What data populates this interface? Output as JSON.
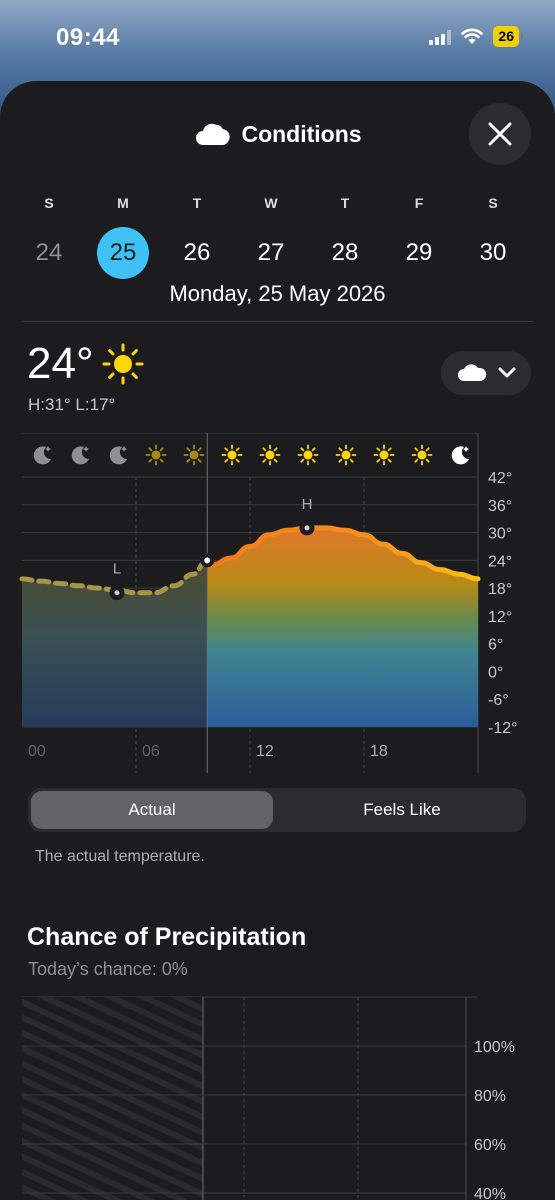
{
  "status_bar": {
    "time": "09:44",
    "battery": "26"
  },
  "header": {
    "title": "Conditions",
    "icon": "cloud-icon",
    "close_icon": "close-icon"
  },
  "week": [
    {
      "letter": "S",
      "num": "24",
      "state": "past"
    },
    {
      "letter": "M",
      "num": "25",
      "state": "selected"
    },
    {
      "letter": "T",
      "num": "26",
      "state": "future"
    },
    {
      "letter": "W",
      "num": "27",
      "state": "future"
    },
    {
      "letter": "T",
      "num": "28",
      "state": "future"
    },
    {
      "letter": "F",
      "num": "29",
      "state": "future"
    },
    {
      "letter": "S",
      "num": "30",
      "state": "future"
    }
  ],
  "selected_date": "Monday, 25 May 2026",
  "current": {
    "temp": "24°",
    "condition_icon": "sun-icon",
    "high_low": "H:31° L:17°"
  },
  "metric_selector": {
    "icon": "cloud-icon",
    "chevron": "chevron-down-icon"
  },
  "temperature_chart": {
    "hourly_icons": [
      "moon-icon",
      "moon-icon",
      "moon-icon",
      "sun-dim-icon",
      "sun-dim-icon",
      "sun-icon",
      "sun-icon",
      "sun-icon",
      "sun-icon",
      "sun-icon",
      "sun-icon",
      "moon-icon"
    ],
    "y_ticks": [
      "42°",
      "36°",
      "30°",
      "24°",
      "18°",
      "12°",
      "6°",
      "0°",
      "-6°",
      "-12°"
    ],
    "x_ticks": [
      "00",
      "06",
      "12",
      "18"
    ],
    "high_label": "H",
    "low_label": "L",
    "chart_data": {
      "type": "line",
      "x": [
        0,
        1,
        2,
        3,
        4,
        5,
        6,
        7,
        8,
        9,
        10,
        11,
        12,
        13,
        14,
        15,
        16,
        17,
        18,
        19,
        20,
        21,
        22,
        23,
        24
      ],
      "values": [
        20,
        19.5,
        19,
        18.5,
        18,
        17.5,
        17,
        17,
        18.5,
        21,
        23,
        24.5,
        27,
        29.5,
        30.5,
        31,
        31,
        30.5,
        29.5,
        27.5,
        25.5,
        23.5,
        22,
        21,
        20
      ],
      "ylim": [
        -12,
        42
      ],
      "xlim": [
        0,
        24
      ],
      "current_hour": 9.75,
      "low": {
        "x": 5,
        "y": 17
      },
      "high": {
        "x": 15,
        "y": 31
      },
      "current": {
        "x": 9.75,
        "y": 24
      }
    }
  },
  "segmented": {
    "actual": "Actual",
    "feels_like": "Feels Like",
    "selected": "actual",
    "note": "The actual temperature."
  },
  "precipitation": {
    "title": "Chance of Precipitation",
    "subtitle": "Today’s chance: 0%",
    "y_ticks": [
      "100%",
      "80%",
      "60%",
      "40%"
    ]
  }
}
